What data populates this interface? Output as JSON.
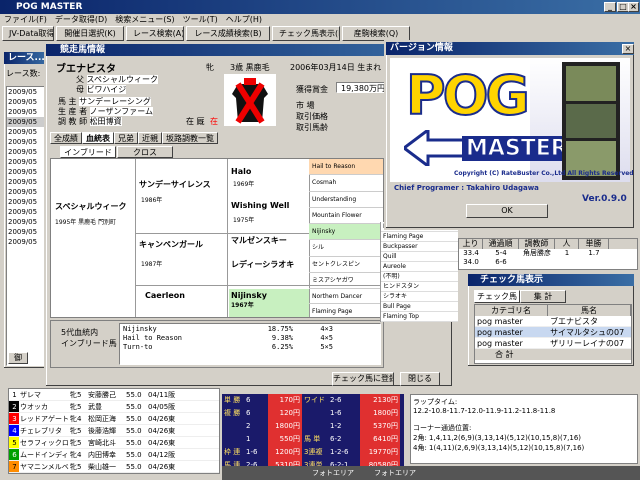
{
  "app": {
    "title": "POG MASTER",
    "menu": [
      "ファイル(F)",
      "データ取得(D)",
      "検索メニュー(S)",
      "ツール(T)",
      "ヘルプ(H)"
    ],
    "toolbar": [
      "JV-Data取得(J)",
      "開催日選択(K)",
      "レース検索(A)",
      "レース成績検索(B)",
      "チェック馬表示(E)",
      "産駒検索(Q)"
    ]
  },
  "race_window": {
    "title": "レース...",
    "label": "レース数:",
    "dates": [
      "2009/05",
      "2009/05",
      "2009/05",
      "2009/05",
      "2009/05",
      "2009/05",
      "2009/05",
      "2009/05",
      "2009/05",
      "2009/05",
      "2009/05",
      "2009/05",
      "2009/05",
      "2009/05",
      "2009/05",
      "2009/05"
    ]
  },
  "horse": {
    "window_title": "競走馬情報",
    "name": "ブエナビスタ",
    "sex": "牝",
    "age": "3歳 黒鹿毛",
    "birth": "2006年03月14日 生まれ",
    "sire_label": "父",
    "sire": "スペシャルウィーク",
    "dam_label": "母",
    "dam": "ビワハイジ",
    "owner_label": "馬 主",
    "owner": "サンデーレーシング",
    "breeder_label": "生 産 者",
    "breeder": "ノーザンファーム",
    "trainer_label": "調 教 師",
    "trainer": "松田博資",
    "stable_label": "在 厩",
    "stable": "在",
    "prize_label": "獲得賞金",
    "prize": "19,380万円",
    "market_label": "市 場",
    "price_label": "取引価格",
    "mkt_horse_label": "取引馬齢",
    "tabs": [
      "全成績",
      "血統表",
      "兄弟",
      "近親",
      "坂路調教一覧"
    ],
    "subtabs": [
      "インブリード",
      "クロス"
    ],
    "ped_sire": "スペシャルウィーク",
    "ped_sire_info": "1995年 黒鹿毛 門別町",
    "ss": "サンデーサイレンス",
    "ss_year": "1986年",
    "ss_s": "Halo",
    "ss_s_year": "1969年",
    "ss_d": "Wishing Well",
    "ss_d_year": "1975年",
    "cg": "キャンペンガール",
    "cg_year": "1987年",
    "cg_s": "マルゼンスキー",
    "cg_d": "レディーシラオキ",
    "g4": [
      "Hail to Reason",
      "Cosmah",
      "Understanding",
      "Mountain Flower",
      "Nijinsky",
      "シル",
      "セントクレスピン",
      "ミスアシヤガワ"
    ],
    "g5": [
      "Nearctic",
      "Flaming Page",
      "Buckpasser",
      "Quill",
      "Aureole",
      "(不明)",
      "ヒンドスタン",
      "シラオキ"
    ],
    "dam_side": "Caerleon",
    "dam_side_s": "Nijinsky",
    "dam_side_s_year": "1967年",
    "dam_g4": [
      "Northern Dancer",
      "Flaming Page"
    ],
    "dam_g5": [
      "Bull Page",
      "Flaming Top"
    ],
    "inbreed_title": "5代血統内\nインブリード馬",
    "inbreed": [
      [
        "Nijinsky",
        "18.75%",
        "4×3"
      ],
      [
        "Hail to Reason",
        "9.38%",
        "4×5"
      ],
      [
        "Turn-to",
        "6.25%",
        "5×5"
      ]
    ],
    "register_button": "チェック馬に登録",
    "close_button": "閉じる"
  },
  "version": {
    "title": "バージョン情報",
    "logo_top": "POG",
    "logo_bottom": "MASTER",
    "copyright": "Copyright (C) RateBuster Co.,Ltd All Rights Reserved.",
    "programmer": "Chief Programer : Takahiro Udagawa",
    "version": "Ver.0.9.0",
    "ok": "OK"
  },
  "check": {
    "title": "チェック馬表示",
    "tabs": [
      "チェック馬",
      "集 計"
    ],
    "headers": [
      "カテゴリ名",
      "馬名"
    ],
    "rows": [
      [
        "pog master",
        "ブエナビスタ"
      ],
      [
        "pog master",
        "サイマルタシュの07"
      ],
      [
        "pog master",
        "ザリリーレイナの07"
      ]
    ],
    "total": "合 計"
  },
  "right_table": {
    "headers": [
      "上り",
      "通過順",
      "調教師",
      "人",
      "単勝"
    ],
    "rows": [
      [
        "33.4",
        "5-4",
        "角居勝彦",
        "1",
        "1.7"
      ],
      [
        "34.0",
        "6-6",
        "",
        "",
        ""
      ]
    ]
  },
  "entries": [
    [
      "1",
      "ザレマ",
      "牝5",
      "安藤勝己",
      "55.0",
      "04/11阪"
    ],
    [
      "2",
      "ウオッカ",
      "牝5",
      "武豊",
      "55.0",
      "04/05阪"
    ],
    [
      "3",
      "レッドアゲート",
      "牝4",
      "松岡正海",
      "55.0",
      "04/26東"
    ],
    [
      "4",
      "チェレブリタ",
      "牝5",
      "後藤浩輝",
      "55.0",
      "04/26東"
    ],
    [
      "5",
      "セラフィックロンプ",
      "牝5",
      "宮崎北斗",
      "55.0",
      "04/26東"
    ],
    [
      "6",
      "ムードインディゴ",
      "牝4",
      "内田博幸",
      "55.0",
      "04/12阪"
    ],
    [
      "7",
      "ヤマニンメルベイユ",
      "牝5",
      "柴山雄一",
      "55.0",
      "04/26東"
    ]
  ],
  "entry_colors": [
    "#ffffff",
    "#000000",
    "#ff0000",
    "#0000ff",
    "#ffff00",
    "#00a000",
    "#ff8c00"
  ],
  "payouts": [
    [
      "単 勝",
      "6",
      "170円",
      "ワイド",
      "2-6",
      "2130円"
    ],
    [
      "複 勝",
      "6",
      "120円",
      "",
      "1-6",
      "1800円"
    ],
    [
      "",
      "2",
      "1800円",
      "",
      "1-2",
      "5370円"
    ],
    [
      "",
      "1",
      "550円",
      "馬 単",
      "6-2",
      "6410円"
    ],
    [
      "枠 連",
      "1-6",
      "1200円",
      "3連複",
      "1-2-6",
      "19770円"
    ],
    [
      "馬 連",
      "2-6",
      "5310円",
      "3連単",
      "6-2-1",
      "80580円"
    ]
  ],
  "laps": {
    "title": "ラップタイム:",
    "value": "12.2-10.8-11.7-12.0-11.9-11.2-11.8-11.8",
    "corner_title": "コーナー通過位置:",
    "c1": "2角: 1,4,11,2(6,9)(3,13,14)(5,12)(10,15,8)(7,16)",
    "c2": "4角: 1(4,11)(2,6,9)(3,13,14)(5,12)(10,15,8)(7,16)"
  },
  "bottom": {
    "nav": "御",
    "photo1": "フォトエリア",
    "photo2": "フォトエリア"
  }
}
